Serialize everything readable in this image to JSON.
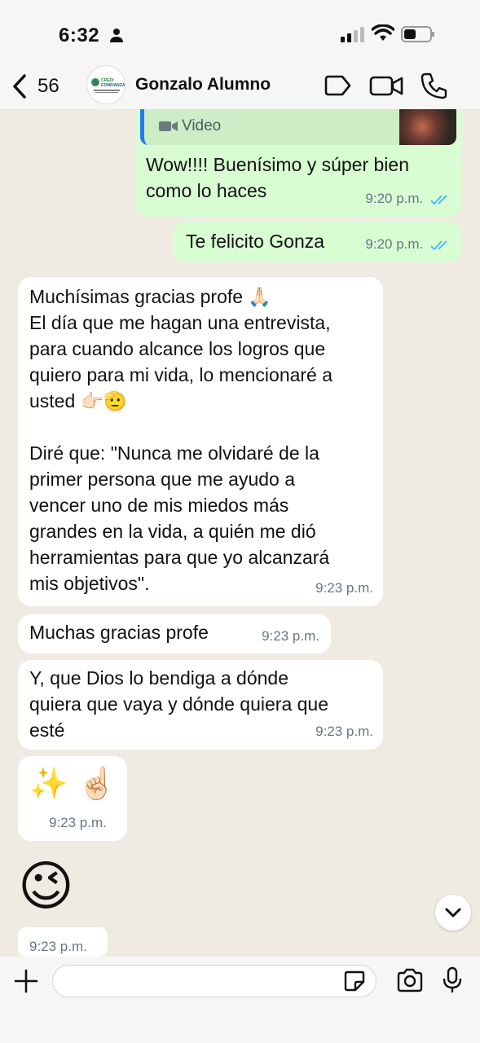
{
  "status_bar": {
    "time": "6:32"
  },
  "header": {
    "back_count": "56",
    "contact_name": "Gonzalo Alumno",
    "avatar_text_1": "CREDI",
    "avatar_text_2": "CONFIANZA"
  },
  "messages": {
    "reply_label": "Video",
    "m1_text_line1": "Wow!!!! Buenísimo y súper bien",
    "m1_text_line2": "como lo haces",
    "m1_time": "9:20 p.m.",
    "m2_text": "Te felicito Gonza",
    "m2_time": "9:20 p.m.",
    "m3_lines": [
      "Muchísimas gracias profe 🙏🏻",
      "El día que me hagan una entrevista,",
      "para cuando alcance los logros que",
      "quiero para mi vida, lo mencionaré a",
      "usted 👉🏻🫡",
      "",
      "Diré que: \"Nunca me olvidaré de la",
      "primer persona que me ayudo a",
      "vencer uno de mis miedos más",
      "grandes en la vida, a quién me dió",
      "herramientas para que yo alcanzará",
      "mis objetivos\"."
    ],
    "m3_time": "9:23 p.m.",
    "m4_text": "Muchas gracias profe",
    "m4_time": "9:23 p.m.",
    "m5_lines": [
      "Y, que Dios lo bendiga a dónde",
      "quiera que vaya y dónde quiera que",
      "esté"
    ],
    "m5_time": "9:23 p.m.",
    "m6_text": "✨ ☝🏻",
    "m6_time": "9:23 p.m.",
    "m7_emoji": "😉",
    "m7_time": "9:23 p.m."
  },
  "input": {
    "placeholder": ""
  },
  "colors": {
    "outgoing": "#d9fdd3",
    "incoming": "#ffffff",
    "read_ticks": "#53bdeb",
    "wallpaper": "#efeae2"
  },
  "icons": [
    "person-icon",
    "signal-icon",
    "wifi-icon",
    "battery-icon",
    "back-chevron-icon",
    "tag-icon",
    "video-call-icon",
    "phone-icon",
    "video-camera-icon",
    "chevron-down-icon",
    "plus-icon",
    "sticker-icon",
    "camera-icon",
    "mic-icon"
  ]
}
